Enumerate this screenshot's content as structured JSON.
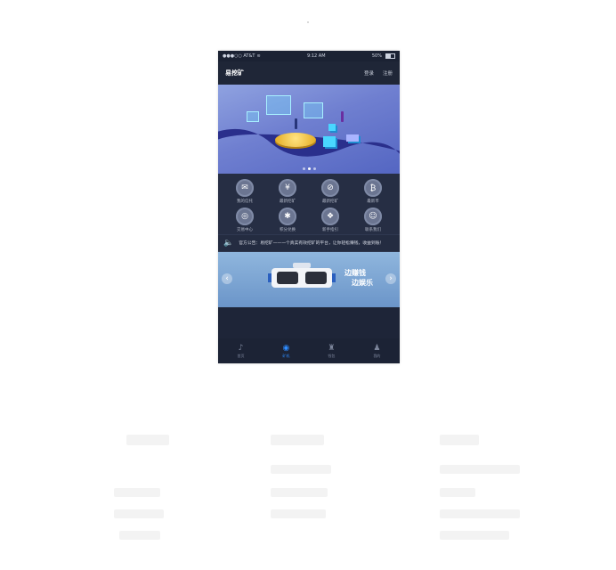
{
  "status_bar": {
    "carrier": "●●●○○ AT&T",
    "time": "9:12 AM",
    "battery": "50%"
  },
  "nav": {
    "title": "易挖矿",
    "login": "登录",
    "register": "注册"
  },
  "banner": {
    "slides": 3,
    "active_slide": 1
  },
  "grid": [
    {
      "label": "我的信托",
      "icon": "chat-icon",
      "glyph": "✉"
    },
    {
      "label": "最新挖矿",
      "icon": "yuan-icon",
      "glyph": "¥"
    },
    {
      "label": "最新挖矿",
      "icon": "compass-icon",
      "glyph": "⊘"
    },
    {
      "label": "最新币",
      "icon": "bitcoin-icon",
      "glyph": "₿"
    },
    {
      "label": "交易中心",
      "icon": "exchange-icon",
      "glyph": "◎"
    },
    {
      "label": "积分兑换",
      "icon": "gift-icon",
      "glyph": "✱"
    },
    {
      "label": "新手指引",
      "icon": "guide-icon",
      "glyph": "❖"
    },
    {
      "label": "联系我们",
      "icon": "message-icon",
      "glyph": "☺"
    }
  ],
  "notice": {
    "text": "官方公告：易挖矿——一个真实有效挖矿的平台，让你轻松赚钱，收益到账！"
  },
  "ad": {
    "line1": "边赚钱",
    "line2": "边娱乐"
  },
  "tabbar": [
    {
      "label": "首页",
      "icon": "home-icon",
      "glyph": "♪"
    },
    {
      "label": "矿机",
      "icon": "mining-icon",
      "glyph": "◉",
      "active": true
    },
    {
      "label": "钱包",
      "icon": "wallet-icon",
      "glyph": "♜"
    },
    {
      "label": "我的",
      "icon": "user-icon",
      "glyph": "♟"
    }
  ],
  "colors": {
    "accent": "#2e8cff",
    "nav_bg": "#1f2637",
    "page_bg": "#262e44"
  }
}
